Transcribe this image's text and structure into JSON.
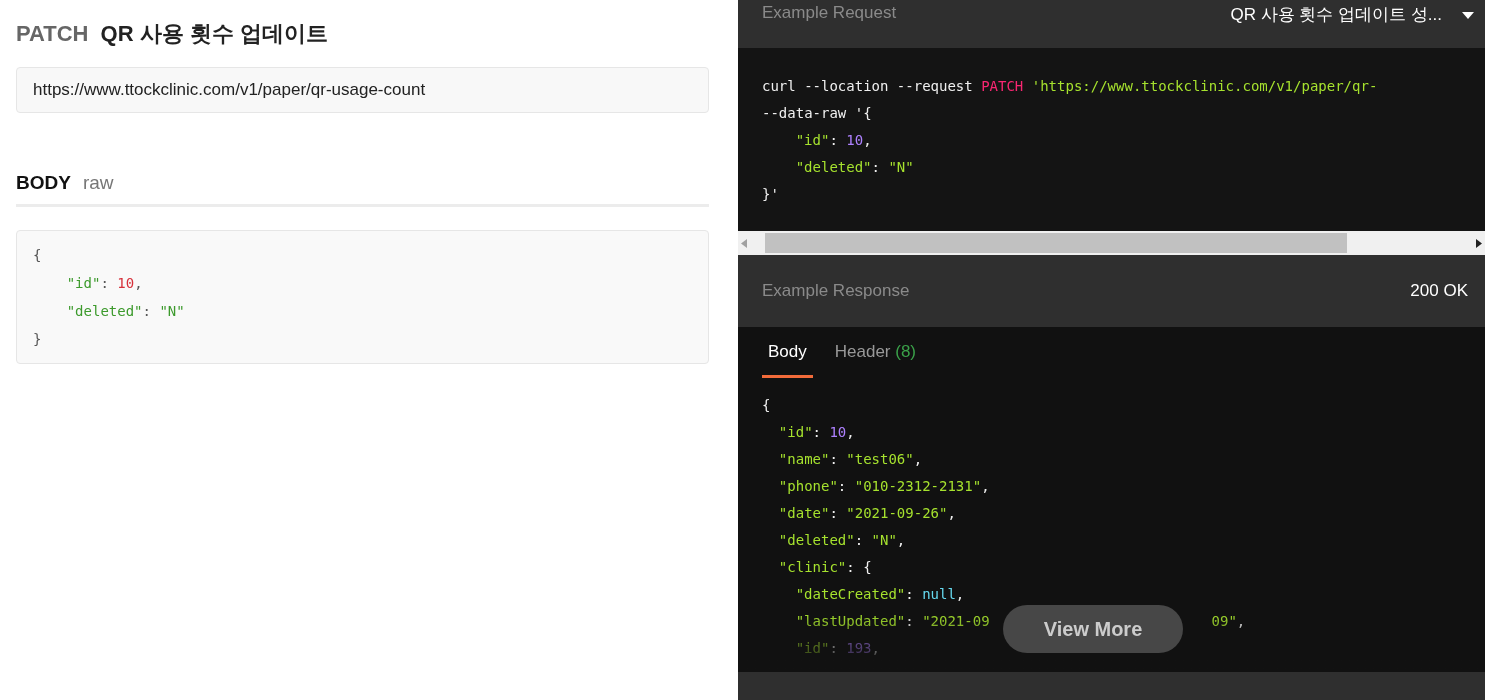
{
  "endpoint": {
    "method": "PATCH",
    "title": "QR 사용 횟수 업데이트",
    "url": "https://www.ttockclinic.com/v1/paper/qr-usage-count"
  },
  "body": {
    "label": "BODY",
    "mode": "raw",
    "code": [
      [
        {
          "t": "{",
          "kind": "punct"
        }
      ],
      [
        {
          "kind": "indent"
        },
        {
          "kind": "indent"
        },
        {
          "t": "\"id\"",
          "kind": "key"
        },
        {
          "t": ": ",
          "kind": "punct"
        },
        {
          "t": "10",
          "kind": "num"
        },
        {
          "t": ",",
          "kind": "punct"
        }
      ],
      [
        {
          "kind": "indent"
        },
        {
          "kind": "indent"
        },
        {
          "t": "\"deleted\"",
          "kind": "key"
        },
        {
          "t": ": ",
          "kind": "punct"
        },
        {
          "t": "\"N\"",
          "kind": "str"
        }
      ],
      [
        {
          "t": "}",
          "kind": "punct"
        }
      ]
    ]
  },
  "example_request": {
    "title": "Example Request",
    "selector": "QR 사용 횟수 업데이트 성...",
    "code": [
      [
        {
          "t": "curl --location --request ",
          "kind": "punct"
        },
        {
          "t": "PATCH",
          "kind": "kw"
        },
        {
          "t": " 'https://www.ttockclinic.com/v1/paper/qr-",
          "kind": "str"
        }
      ],
      [
        {
          "t": "--data-raw '{",
          "kind": "punct"
        }
      ],
      [
        {
          "kind": "indent"
        },
        {
          "kind": "indent"
        },
        {
          "t": "\"id\"",
          "kind": "key"
        },
        {
          "t": ": ",
          "kind": "punct"
        },
        {
          "t": "10",
          "kind": "num"
        },
        {
          "t": ",",
          "kind": "punct"
        }
      ],
      [
        {
          "kind": "indent"
        },
        {
          "kind": "indent"
        },
        {
          "t": "\"deleted\"",
          "kind": "key"
        },
        {
          "t": ": ",
          "kind": "punct"
        },
        {
          "t": "\"N\"",
          "kind": "str"
        }
      ],
      [
        {
          "t": "}'",
          "kind": "punct"
        }
      ]
    ]
  },
  "example_response": {
    "title": "Example Response",
    "status": "200 OK",
    "tabs": [
      {
        "label": "Body",
        "selected": true
      },
      {
        "label": "Header",
        "count": "(8)",
        "selected": false
      }
    ],
    "code": [
      [
        {
          "t": "{",
          "kind": "punct"
        }
      ],
      [
        {
          "kind": "indent"
        },
        {
          "t": "\"id\"",
          "kind": "key"
        },
        {
          "t": ": ",
          "kind": "punct"
        },
        {
          "t": "10",
          "kind": "num"
        },
        {
          "t": ",",
          "kind": "punct"
        }
      ],
      [
        {
          "kind": "indent"
        },
        {
          "t": "\"name\"",
          "kind": "key"
        },
        {
          "t": ": ",
          "kind": "punct"
        },
        {
          "t": "\"test06\"",
          "kind": "str"
        },
        {
          "t": ",",
          "kind": "punct"
        }
      ],
      [
        {
          "kind": "indent"
        },
        {
          "t": "\"phone\"",
          "kind": "key"
        },
        {
          "t": ": ",
          "kind": "punct"
        },
        {
          "t": "\"010-2312-2131\"",
          "kind": "str"
        },
        {
          "t": ",",
          "kind": "punct"
        }
      ],
      [
        {
          "kind": "indent"
        },
        {
          "t": "\"date\"",
          "kind": "key"
        },
        {
          "t": ": ",
          "kind": "punct"
        },
        {
          "t": "\"2021-09-26\"",
          "kind": "str"
        },
        {
          "t": ",",
          "kind": "punct"
        }
      ],
      [
        {
          "kind": "indent"
        },
        {
          "t": "\"deleted\"",
          "kind": "key"
        },
        {
          "t": ": ",
          "kind": "punct"
        },
        {
          "t": "\"N\"",
          "kind": "str"
        },
        {
          "t": ",",
          "kind": "punct"
        }
      ],
      [
        {
          "kind": "indent"
        },
        {
          "t": "\"clinic\"",
          "kind": "key"
        },
        {
          "t": ": {",
          "kind": "punct"
        }
      ],
      [
        {
          "kind": "indent"
        },
        {
          "kind": "indent"
        },
        {
          "t": "\"dateCreated\"",
          "kind": "key"
        },
        {
          "t": ": ",
          "kind": "punct"
        },
        {
          "t": "null",
          "kind": "null"
        },
        {
          "t": ",",
          "kind": "punct"
        }
      ],
      [
        {
          "kind": "indent"
        },
        {
          "kind": "indent"
        },
        {
          "t": "\"lastUpdated\"",
          "kind": "key"
        },
        {
          "t": ": ",
          "kind": "punct"
        },
        {
          "t": "\"2021-09",
          "kind": "str"
        },
        {
          "kind": "gap"
        },
        {
          "t": "09\"",
          "kind": "str"
        },
        {
          "t": ",",
          "kind": "punct"
        }
      ],
      [
        {
          "kind": "indent"
        },
        {
          "kind": "indent"
        },
        {
          "t": "\"id\"",
          "kind": "key"
        },
        {
          "t": ": ",
          "kind": "punct"
        },
        {
          "t": "193",
          "kind": "num"
        },
        {
          "t": ",",
          "kind": "punct"
        }
      ]
    ],
    "view_more": "View More"
  }
}
